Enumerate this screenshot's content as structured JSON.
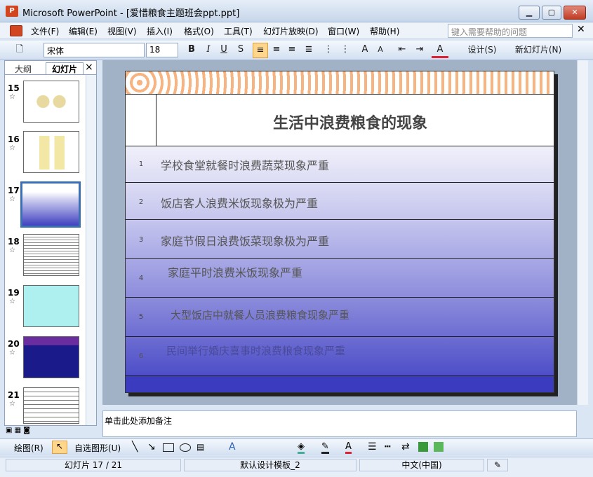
{
  "window": {
    "title": "Microsoft PowerPoint - [爱惜粮食主题班会ppt.ppt]"
  },
  "menu": {
    "items": [
      "文件(F)",
      "编辑(E)",
      "视图(V)",
      "插入(I)",
      "格式(O)",
      "工具(T)",
      "幻灯片放映(D)",
      "窗口(W)",
      "帮助(H)"
    ],
    "help_placeholder": "键入需要帮助的问题"
  },
  "toolbar": {
    "font": "宋体",
    "size": "18",
    "bold": "B",
    "italic": "I",
    "underline": "U",
    "shadow": "S",
    "design": "设计(S)",
    "new_slide": "新幻灯片(N)"
  },
  "panel": {
    "tab_outline": "大纲",
    "tab_slides": "幻灯片",
    "close": "×",
    "slides": [
      {
        "num": "15"
      },
      {
        "num": "16"
      },
      {
        "num": "17"
      },
      {
        "num": "18"
      },
      {
        "num": "19"
      },
      {
        "num": "20"
      },
      {
        "num": "21"
      }
    ]
  },
  "slide": {
    "title": "生活中浪费粮食的现象",
    "rows": [
      {
        "num": "1",
        "text": "学校食堂就餐时浪费蔬菜现象严重"
      },
      {
        "num": "2",
        "text": "饭店客人浪费米饭现象极为严重"
      },
      {
        "num": "3",
        "text": "家庭节假日浪费饭菜现象极为严重"
      },
      {
        "num": "4",
        "text": "家庭平时浪费米饭现象严重"
      },
      {
        "num": "5",
        "text": "大型饭店中就餐人员浪费粮食现象严重"
      },
      {
        "num": "6",
        "text": "民间举行婚庆喜事时浪费粮食现象严重"
      }
    ]
  },
  "notes": {
    "placeholder": "单击此处添加备注"
  },
  "drawbar": {
    "draw": "绘图(R)",
    "autoshapes": "自选图形(U)"
  },
  "status": {
    "slide": "幻灯片 17 / 21",
    "template": "默认设计模板_2",
    "lang": "中文(中国)"
  }
}
